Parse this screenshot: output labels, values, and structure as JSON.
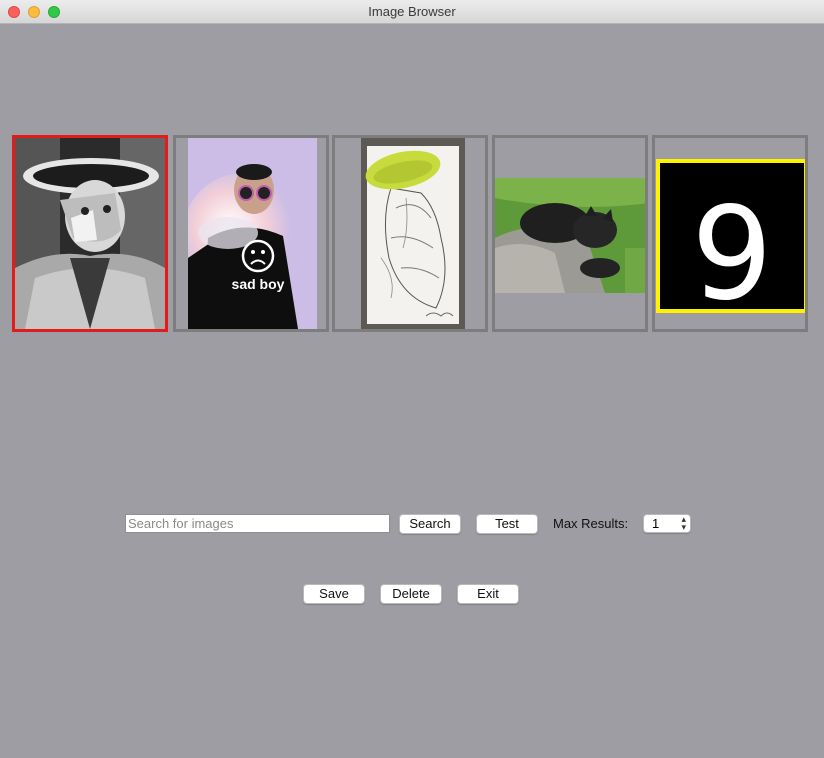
{
  "window": {
    "title": "Image Browser"
  },
  "gallery": {
    "items": [
      {
        "id": "masked-man",
        "selected": true
      },
      {
        "id": "sad-boy"
      },
      {
        "id": "sketch"
      },
      {
        "id": "cat"
      },
      {
        "id": "digit",
        "label": "9"
      }
    ],
    "selection_color": "#e31b1b",
    "highlight_color": "#fff200"
  },
  "search": {
    "placeholder": "Search for images",
    "value": "",
    "search_label": "Search",
    "test_label": "Test",
    "max_results_label": "Max Results:",
    "max_results_value": "1"
  },
  "actions": {
    "save_label": "Save",
    "delete_label": "Delete",
    "exit_label": "Exit"
  }
}
